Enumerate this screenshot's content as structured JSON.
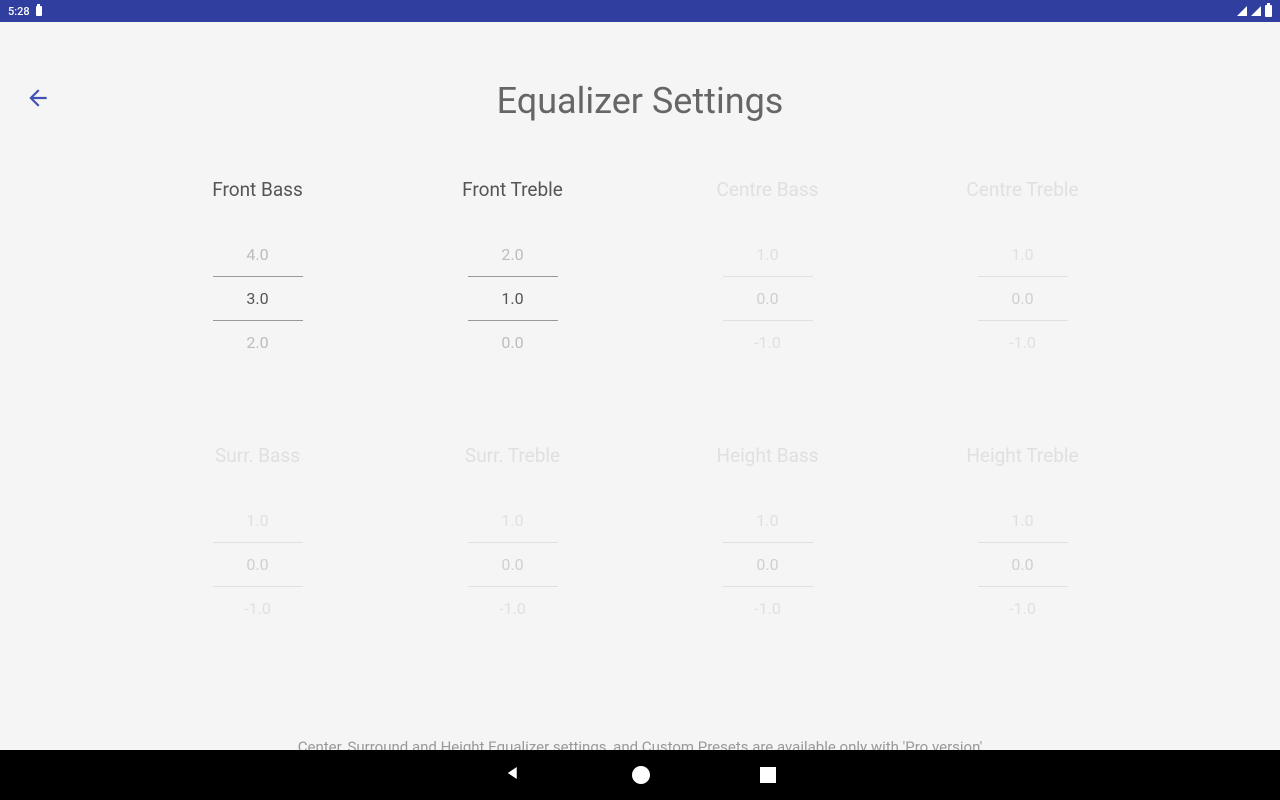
{
  "status": {
    "time": "5:28"
  },
  "header": {
    "title": "Equalizer Settings"
  },
  "eq": [
    {
      "label": "Front Bass",
      "enabled": true,
      "above": "4.0",
      "selected": "3.0",
      "below": "2.0"
    },
    {
      "label": "Front Treble",
      "enabled": true,
      "above": "2.0",
      "selected": "1.0",
      "below": "0.0"
    },
    {
      "label": "Centre Bass",
      "enabled": false,
      "above": "1.0",
      "selected": "0.0",
      "below": "-1.0"
    },
    {
      "label": "Centre Treble",
      "enabled": false,
      "above": "1.0",
      "selected": "0.0",
      "below": "-1.0"
    },
    {
      "label": "Surr. Bass",
      "enabled": false,
      "above": "1.0",
      "selected": "0.0",
      "below": "-1.0"
    },
    {
      "label": "Surr. Treble",
      "enabled": false,
      "above": "1.0",
      "selected": "0.0",
      "below": "-1.0"
    },
    {
      "label": "Height Bass",
      "enabled": false,
      "above": "1.0",
      "selected": "0.0",
      "below": "-1.0"
    },
    {
      "label": "Height Treble",
      "enabled": false,
      "above": "1.0",
      "selected": "0.0",
      "below": "-1.0"
    }
  ],
  "footer": {
    "note": "Center, Surround and Height Equalizer settings, and Custom Presets are available only with 'Pro version'"
  }
}
